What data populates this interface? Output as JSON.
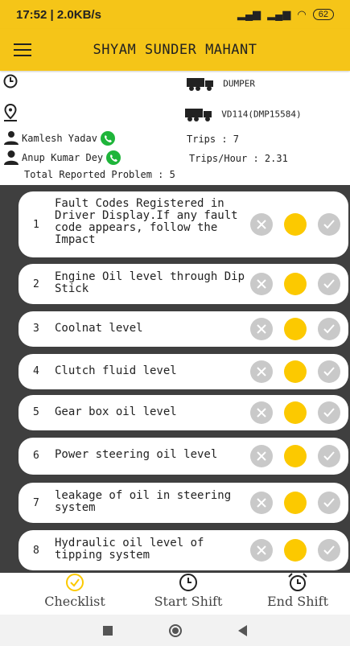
{
  "status_bar": {
    "time_speed": "17:52 | 2.0KB/s",
    "battery": "62"
  },
  "app_bar": {
    "title": "SHYAM SUNDER MAHANT"
  },
  "info": {
    "vehicle_type": "DUMPER",
    "vehicle_id": "VD114(DMP15584)",
    "operator1": "Kamlesh Yadav",
    "operator2": "Anup Kumar Dey",
    "trips": "Trips : 7",
    "trips_per_hour": "Trips/Hour : 2.31",
    "total_problems": "Total Reported Problem : 5"
  },
  "checklist": [
    {
      "num": "1",
      "text": "Fault Codes Registered in Driver Display.If any fault code appears, follow the Impact"
    },
    {
      "num": "2",
      "text": "Engine Oil level through Dip Stick"
    },
    {
      "num": "3",
      "text": "Coolnat level"
    },
    {
      "num": "4",
      "text": "Clutch fluid level"
    },
    {
      "num": "5",
      "text": "Gear box oil level"
    },
    {
      "num": "6",
      "text": "Power steering oil level"
    },
    {
      "num": "7",
      "text": "leakage of oil in steering system"
    },
    {
      "num": "8",
      "text": "Hydraulic oil level of tipping system"
    }
  ],
  "bottom_nav": {
    "checklist": "Checklist",
    "start_shift": "Start Shift",
    "end_shift": "End Shift"
  },
  "colors": {
    "accent": "#f5c518",
    "selected": "#fcc900",
    "inactive": "#c9c9c9",
    "call": "#1eb53a",
    "list_bg": "#3f3f3f"
  }
}
